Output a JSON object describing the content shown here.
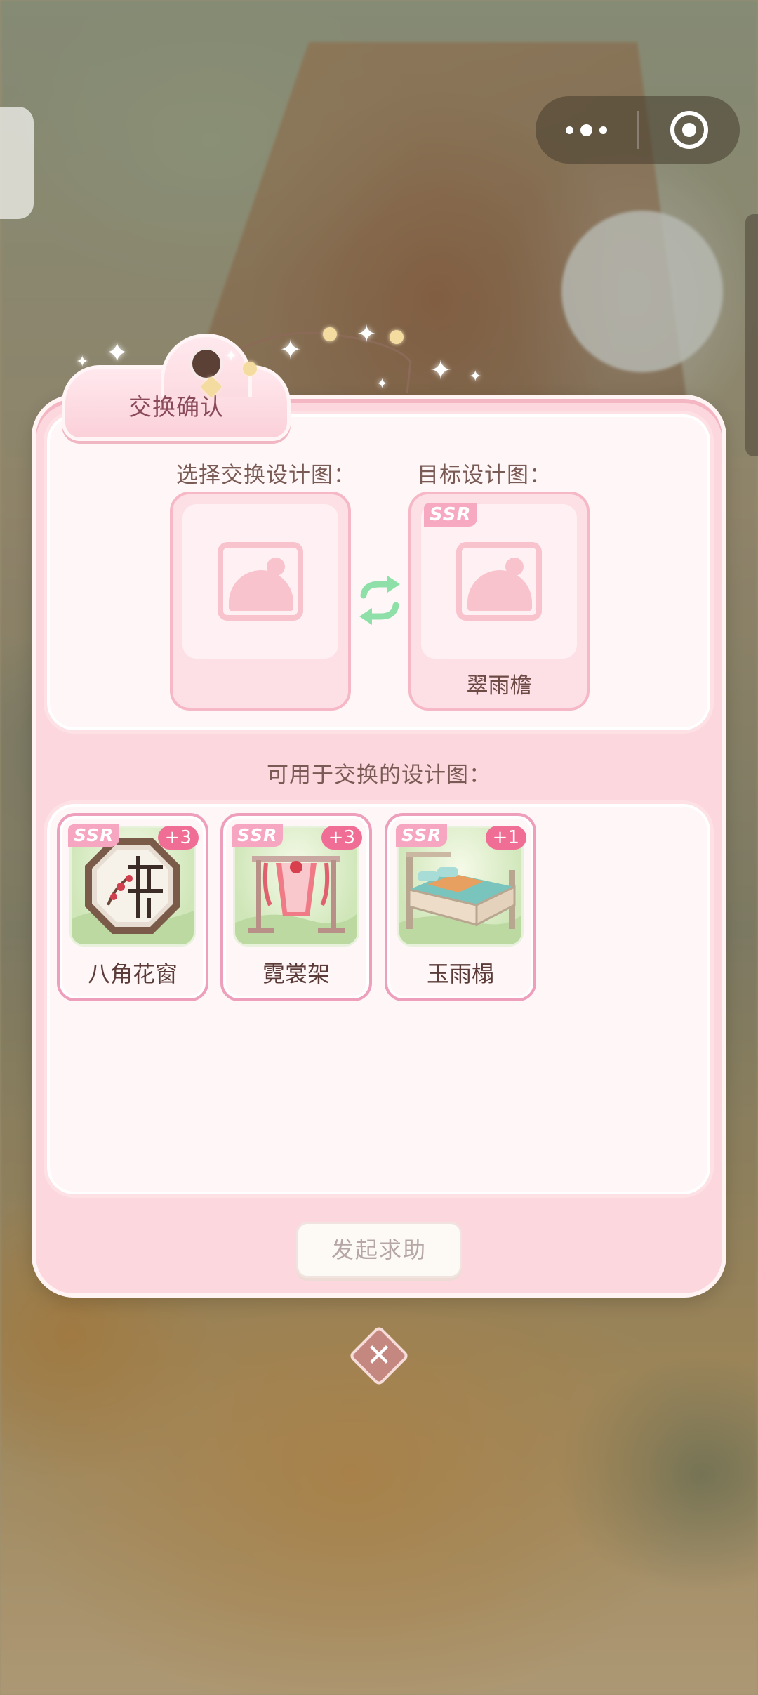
{
  "dialog": {
    "title": "交换确认",
    "select_label": "选择交换设计图：",
    "target_label": "目标设计图：",
    "available_label": "可用于交换的设计图：",
    "help_button": "发起求助"
  },
  "target_slot": {
    "rarity": "SSR",
    "name": "翠雨檐"
  },
  "available_items": [
    {
      "rarity": "SSR",
      "count": "+3",
      "name": "八角花窗"
    },
    {
      "rarity": "SSR",
      "count": "+3",
      "name": "霓裳架"
    },
    {
      "rarity": "SSR",
      "count": "+1",
      "name": "玉雨榻"
    }
  ],
  "icons": {
    "swap": "swap-arrows-icon",
    "close": "close-icon",
    "placeholder": "image-placeholder-icon"
  },
  "colors": {
    "panel_pink": "#fcd7dd",
    "badge_pink": "#f06e95",
    "ssr_pink": "#f6a6c0",
    "swap_green": "#8fe0a8"
  }
}
